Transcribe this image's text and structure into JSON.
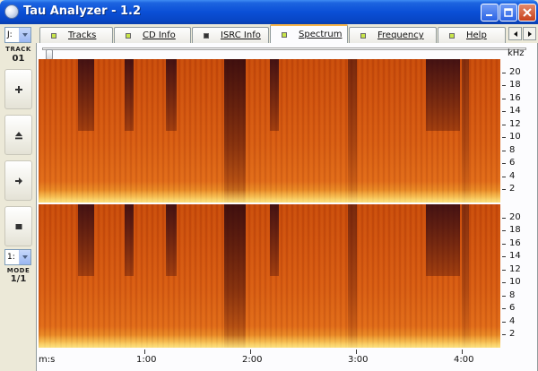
{
  "window": {
    "title": "Tau Analyzer - 1.2",
    "accent": "#0a4fd6",
    "buttons": [
      "minimize-icon",
      "maximize-icon",
      "close-icon"
    ]
  },
  "left_panel": {
    "drive_value": "J:",
    "track_label": "TRACK",
    "track_value": "01",
    "buttons": [
      "plus-icon",
      "eject-icon",
      "arrow-right-icon",
      "stop-icon"
    ],
    "mode_select_value": "1:",
    "mode_label": "MODE",
    "mode_value": "1/1"
  },
  "tabs": [
    {
      "label": "Tracks",
      "active": false
    },
    {
      "label": "CD Info",
      "active": false
    },
    {
      "label": "ISRC Info",
      "active": false
    },
    {
      "label": "Spectrum",
      "active": true
    },
    {
      "label": "Frequency",
      "active": false
    },
    {
      "label": "Help",
      "active": false
    }
  ],
  "spectrum": {
    "freq_unit": "kHz",
    "freq_ticks": [
      "20",
      "18",
      "16",
      "14",
      "12",
      "10",
      "8",
      "6",
      "4",
      "2"
    ],
    "time_axis_label": "m:s",
    "time_ticks": [
      "1:00",
      "2:00",
      "3:00",
      "4:00"
    ],
    "colors": {
      "low": "#3a0a1a",
      "mid": "#d0520e",
      "high": "#f7d26a"
    }
  }
}
